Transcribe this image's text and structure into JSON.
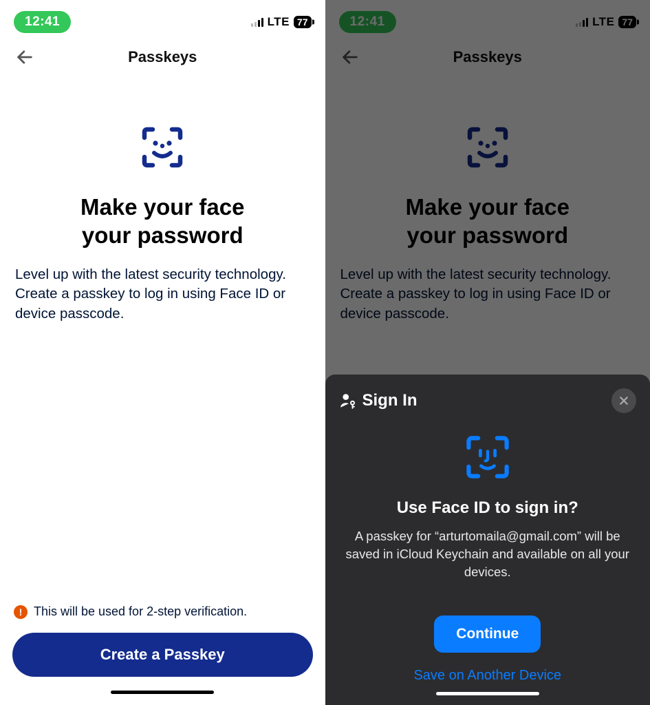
{
  "status": {
    "time": "12:41",
    "network": "LTE",
    "battery": "77"
  },
  "nav": {
    "title": "Passkeys"
  },
  "hero": {
    "headline_line1": "Make your face",
    "headline_line2": "your password",
    "subtext": "Level up with the latest security technology. Create a passkey to log in using Face ID or device passcode."
  },
  "footer": {
    "info": "This will be used for 2-step verification.",
    "cta": "Create a Passkey"
  },
  "sheet": {
    "signin": "Sign In",
    "heading": "Use Face ID to sign in?",
    "body": "A passkey for “arturtomaila@gmail.com” will be saved in iCloud Keychain and available on all your devices.",
    "continue": "Continue",
    "alt": "Save on Another Device"
  }
}
